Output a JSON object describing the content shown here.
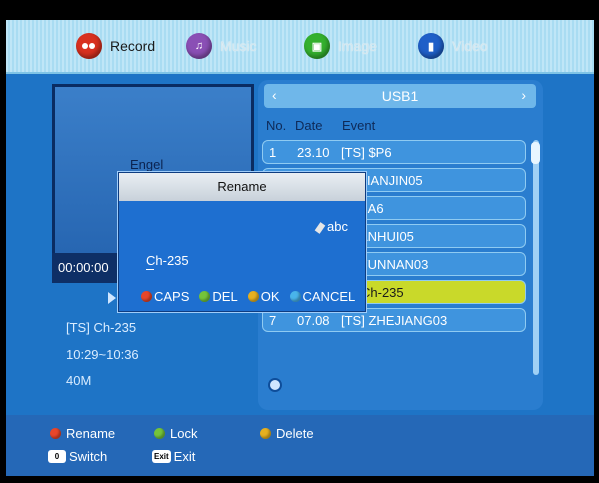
{
  "tabs": [
    {
      "icon": "record-icon",
      "label": "Record",
      "active": true,
      "color": "#d8301f"
    },
    {
      "icon": "music-icon",
      "label": "Music",
      "active": false,
      "color": "#8a4fb5"
    },
    {
      "icon": "image-icon",
      "label": "Image",
      "active": false,
      "color": "#34b02e"
    },
    {
      "icon": "video-icon",
      "label": "Video",
      "active": false,
      "color": "#1f5fc8"
    }
  ],
  "preview": {
    "text": "Engel",
    "time": "00:00:00",
    "info_name": "[TS] Ch-235",
    "info_time": "10:29~10:36",
    "info_size": "40M"
  },
  "list": {
    "source": "USB1",
    "prev_arrow": "‹",
    "next_arrow": "›",
    "columns": {
      "no": "No.",
      "date": "Date",
      "event": "Event"
    },
    "rows": [
      {
        "no": "1",
        "date": "23.10",
        "event": "[TS] $P6",
        "selected": false
      },
      {
        "no": "",
        "date": "",
        "event": "TIANJIN05",
        "selected": false
      },
      {
        "no": "",
        "date": "",
        "event": "SA6",
        "selected": false
      },
      {
        "no": "",
        "date": "",
        "event": "ANHUI05",
        "selected": false
      },
      {
        "no": "",
        "date": "",
        "event": "YUNNAN03",
        "selected": false
      },
      {
        "no": "",
        "date": "",
        "event": "Ch-235",
        "selected": true
      },
      {
        "no": "7",
        "date": "07.08",
        "event": "[TS] ZHEJIANG03",
        "selected": false
      }
    ]
  },
  "dialog": {
    "title": "Rename",
    "mode": "abc",
    "value": "Ch-235",
    "buttons": [
      {
        "label": "CAPS",
        "color": "#e8462a"
      },
      {
        "label": "DEL",
        "color": "#74c43a"
      },
      {
        "label": "OK",
        "color": "#e6b020"
      },
      {
        "label": "CANCEL",
        "color": "#49b4ea"
      }
    ]
  },
  "footer": {
    "rename": {
      "label": "Rename",
      "color": "#e8462a"
    },
    "lock": {
      "label": "Lock",
      "color": "#74c43a"
    },
    "delete": {
      "label": "Delete",
      "color": "#e6b020"
    },
    "switch": {
      "key": "0",
      "label": "Switch"
    },
    "exit": {
      "key": "Exit",
      "label": "Exit"
    }
  }
}
